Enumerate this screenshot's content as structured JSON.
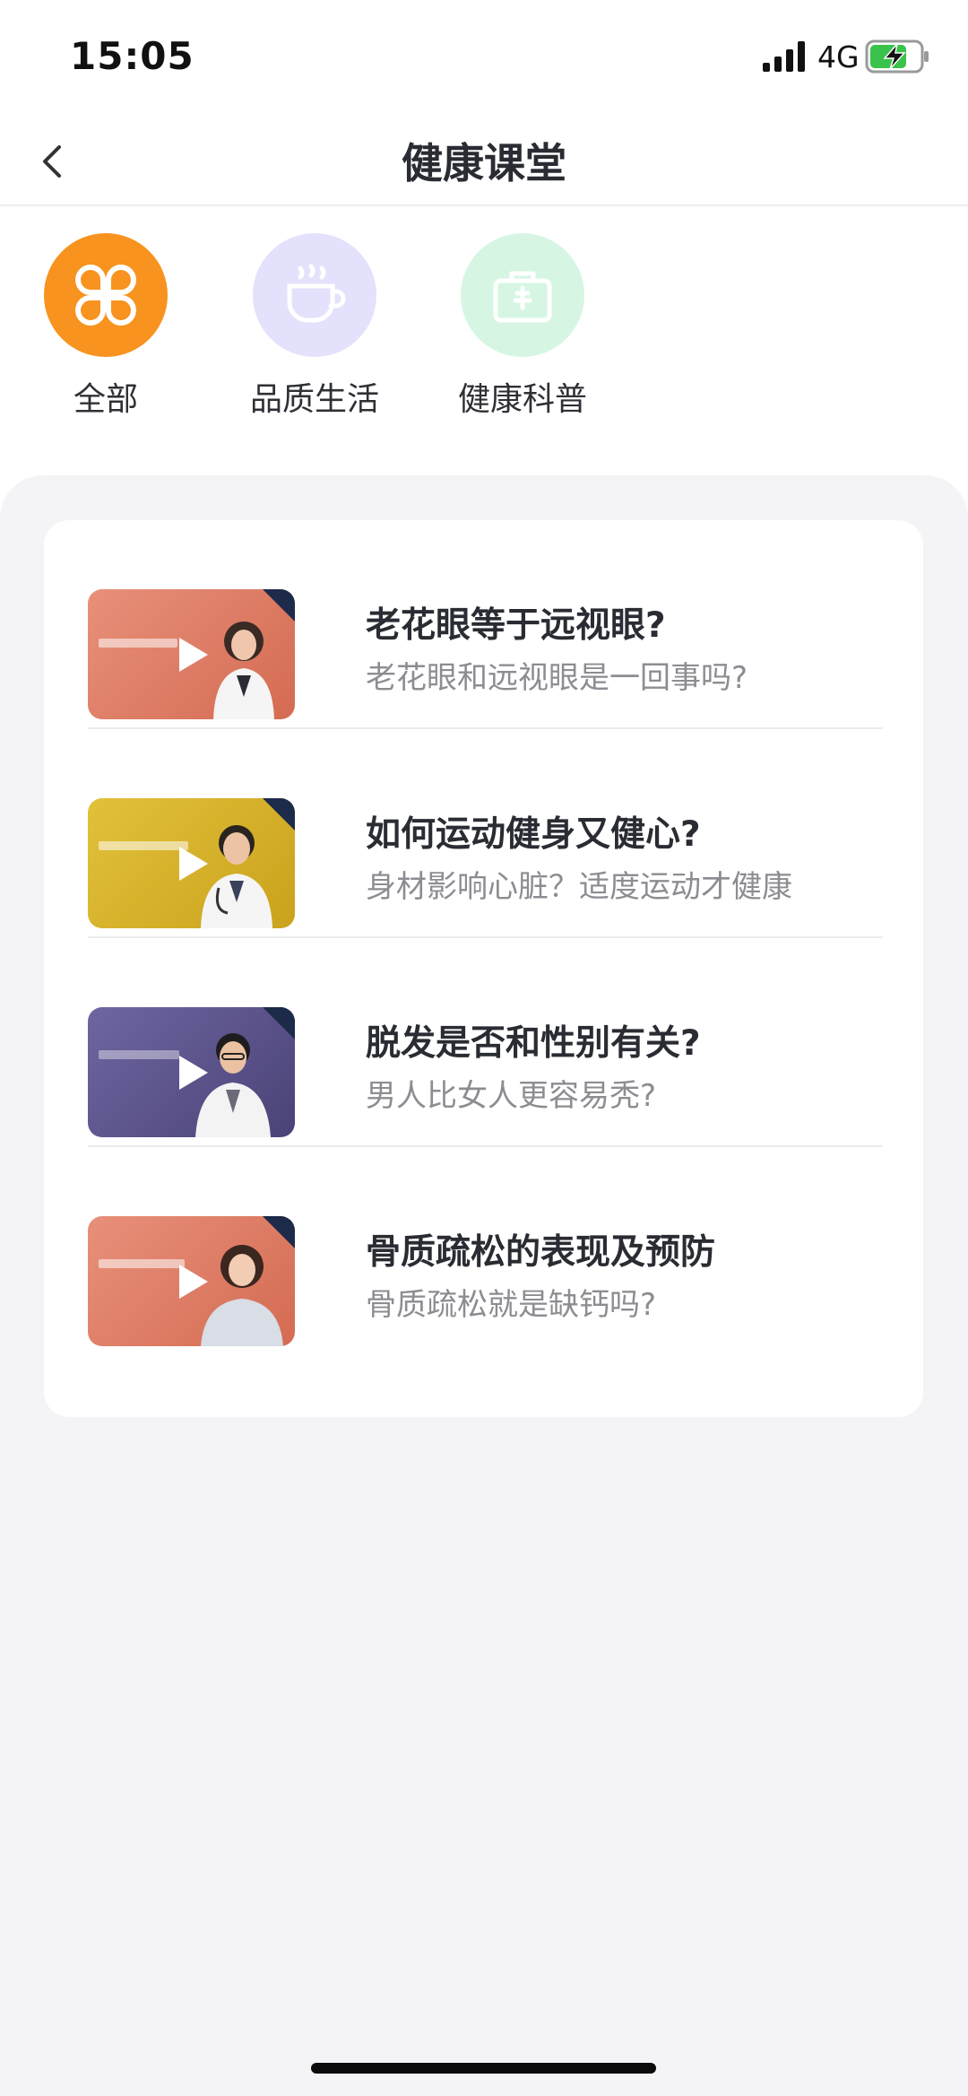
{
  "status_bar": {
    "time": "15:05",
    "network": "4G"
  },
  "nav": {
    "title": "健康课堂"
  },
  "categories": [
    {
      "label": "全部",
      "icon": "clover-grid-icon",
      "color": "#F7931E",
      "selected": true
    },
    {
      "label": "品质生活",
      "icon": "coffee-cup-icon",
      "color": "#E3E1FB"
    },
    {
      "label": "健康科普",
      "icon": "medical-kit-icon",
      "color": "#D6F6E3"
    }
  ],
  "courses": [
    {
      "title": "老花眼等于远视眼?",
      "subtitle": "老花眼和远视眼是一回事吗?",
      "thumb_color": "#E4836A"
    },
    {
      "title": "如何运动健身又健心?",
      "subtitle": "身材影响心脏？适度运动才健康",
      "thumb_color": "#D9B52A"
    },
    {
      "title": "脱发是否和性别有关?",
      "subtitle": "男人比女人更容易秃?",
      "thumb_color": "#5E568E"
    },
    {
      "title": "骨质疏松的表现及预防",
      "subtitle": "骨质疏松就是缺钙吗?",
      "thumb_color": "#E4836A"
    }
  ]
}
